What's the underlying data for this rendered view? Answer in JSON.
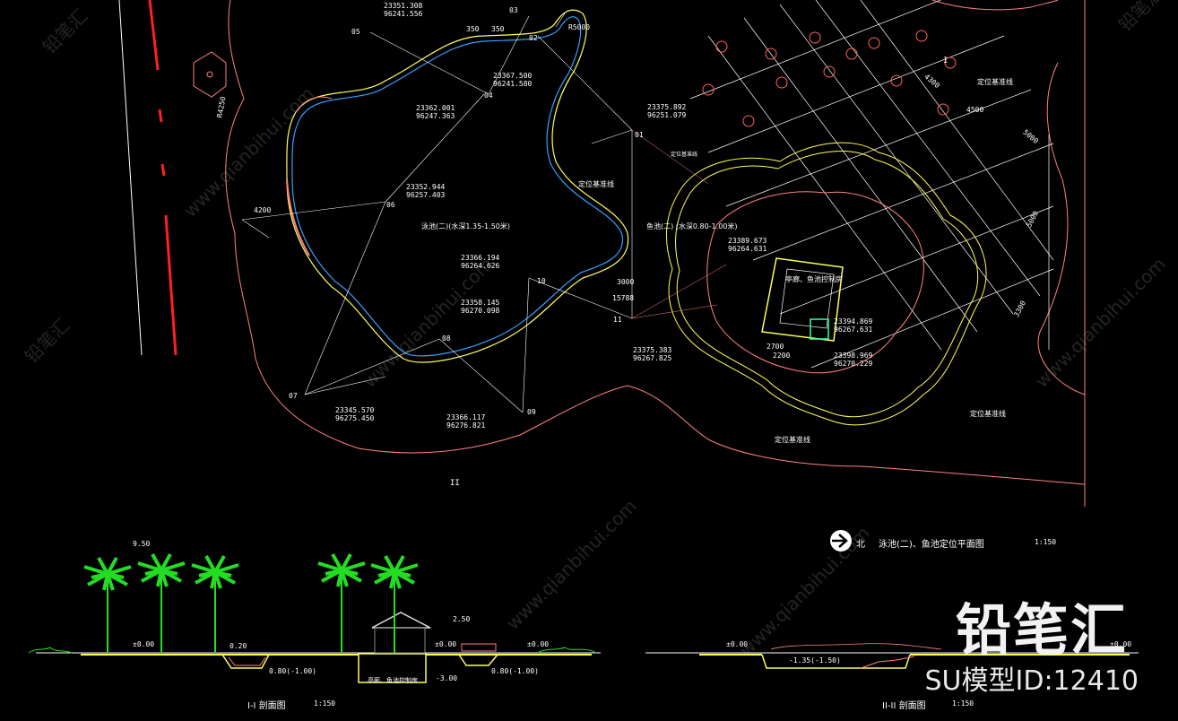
{
  "colors": {
    "background": "#000000",
    "boundary": "#ff8080",
    "pool_edge_blue": "#33a0ff",
    "pool_edge_yellow": "#ffff55",
    "grid": "#ffffff",
    "road_center": "#ff2020",
    "palm_green": "#22dd22"
  },
  "plan_labels": {
    "p01": "01",
    "p02": "02",
    "p03": "03",
    "p04": "04",
    "p05": "05",
    "p06": "06",
    "p07": "07",
    "p08": "08",
    "p09": "09",
    "p10": "10",
    "p11": "11"
  },
  "coords": {
    "c1": "23351.308\n96241.556",
    "c2": "23367.500\n96241.580",
    "c3": "23362.001\n96247.363",
    "c4": "23375.892\n96251.079",
    "c5": "23352.944\n96257.403",
    "c6": "23366.194\n96264.626",
    "c7": "23358.145\n96270.098",
    "c8": "23375.383\n96267.825",
    "c9": "23345.570\n96275.450",
    "c10": "23366.117\n96276.821",
    "c11": "23389.673\n96264.631",
    "c12": "23394.869\n96267.631",
    "c13": "23398.969\n96270.229"
  },
  "dims": {
    "r5000": "R5000",
    "d350a": "350",
    "d350b": "350",
    "r4250": "R4250",
    "d4200": "4200",
    "d3000": "3000",
    "d15788": "15788",
    "d2700": "2700",
    "d2200": "2200",
    "d3300": "3300",
    "d4500": "4500",
    "d5000": "5000",
    "d5000b": "5000",
    "d4300": "4300"
  },
  "annotations": {
    "pool2": "泳池(二)(水深1.35-1.50米)",
    "fishpond": "鱼池(二)\n(水深0.80-1.00米)",
    "datum1": "定位基准线",
    "datum2": "定位基准线",
    "datum3": "定位基准线",
    "datum4": "定位基准线",
    "datum5": "定位基准线",
    "pavilion": "亭廊、鱼池控制房",
    "section_mark_II": "II",
    "section_mark_I": "I"
  },
  "plan_title": {
    "north": "北",
    "text": "泳池(二)、鱼池定位平面图",
    "scale": "1:150"
  },
  "section1": {
    "title": "I-I 剖面图",
    "scale": "1:150",
    "elev_roof": "9.50",
    "elev_ground_left": "±0.00",
    "elev_pool": "0.20",
    "elev_bottom1": "0.80(-1.00)",
    "elev_pavilion_top": "2.50",
    "elev_ground_mid": "±0.00",
    "elev_ground_right": "±0.00",
    "elev_basement": "-3.00",
    "elev_bottom2": "0.80(-1.00)",
    "room_label": "亭廊、鱼池控制房"
  },
  "section2": {
    "title": "II-II 剖面图",
    "scale": "1:150",
    "elev_ground_left": "±0.00",
    "elev_pool": "-1.35(-1.50)",
    "elev_ground_right": "±0.00"
  },
  "watermark": {
    "brand": "铅笔汇",
    "model_id": "SU模型ID:12410",
    "site": "www.qianbihui.com",
    "short": "铅笔汇"
  }
}
